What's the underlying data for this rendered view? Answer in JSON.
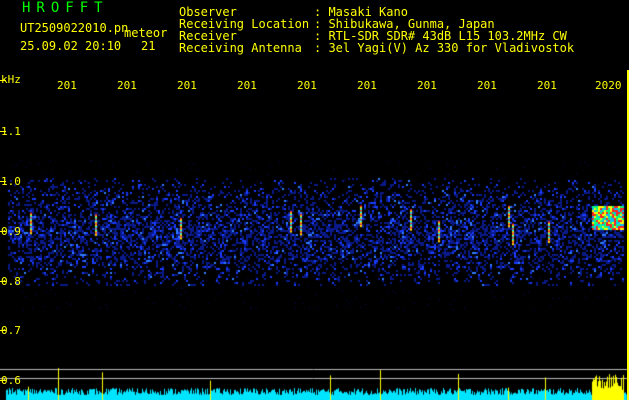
{
  "header": {
    "title": "HROFFT",
    "filename": "UT2509022010.pn",
    "meteor_label": "meteor",
    "timestamp": "25.09.02 20:10",
    "count": "21"
  },
  "info": [
    {
      "label": "Observer",
      "value": ": Masaki Kano"
    },
    {
      "label": "Receiving Location",
      "value": ": Shibukawa, Gunma, Japan"
    },
    {
      "label": "Receiver",
      "value": ": RTL-SDR SDR# 43dB L15 103.2MHz CW"
    },
    {
      "label": "Receiving Antenna",
      "value": ": 3el Yagi(V) Az 330 for Vladivostok"
    }
  ],
  "axis": {
    "unit": "kHz",
    "y_labels": [
      "1.1",
      "1.0",
      "0.9",
      "0.8",
      "0.7",
      "0.6"
    ],
    "x_labels": [
      "201",
      "201",
      "201",
      "201",
      "201",
      "201",
      "201",
      "201",
      "201",
      "2020"
    ]
  },
  "colors": {
    "text": "#ffff00",
    "title": "#00ff00",
    "background": "#000000",
    "amplitude": "#00e5ff"
  }
}
